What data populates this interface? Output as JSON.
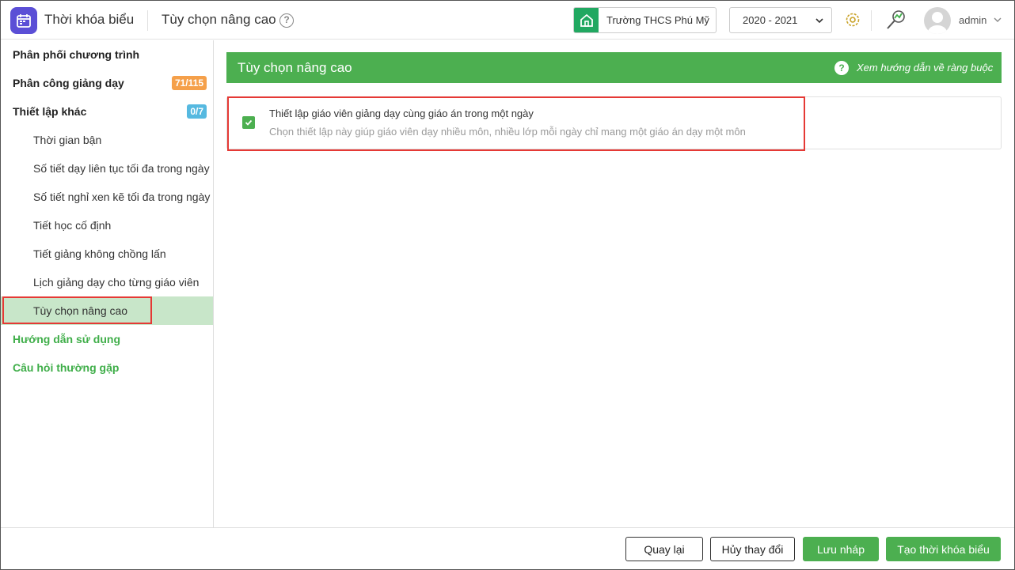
{
  "header": {
    "app_title": "Thời khóa biểu",
    "page_title": "Tùy chọn nâng cao",
    "school": "Trường THCS Phú Mỹ",
    "year": "2020 - 2021",
    "username": "admin",
    "help_icon": "question-circle-icon",
    "settings_icon": "gear-icon",
    "search_icon": "search-icon"
  },
  "sidebar": {
    "items": [
      {
        "label": "Phân phối chương trình"
      },
      {
        "label": "Phân công giảng dạy",
        "badge": "71/115"
      },
      {
        "label": "Thiết lập khác",
        "badge": "0/7"
      },
      {
        "label": "Thời gian bận"
      },
      {
        "label": "Số tiết dạy liên tục tối đa trong ngày"
      },
      {
        "label": "Số tiết nghỉ xen kẽ tối đa trong ngày"
      },
      {
        "label": "Tiết học cố định"
      },
      {
        "label": "Tiết giảng không chồng lấn"
      },
      {
        "label": "Lịch giảng dạy cho từng giáo viên"
      },
      {
        "label": "Tùy chọn nâng cao"
      },
      {
        "label": "Hướng dẫn sử dụng"
      },
      {
        "label": "Câu hỏi thường gặp"
      }
    ]
  },
  "main": {
    "banner_title": "Tùy chọn nâng cao",
    "banner_link": "Xem hướng dẫn về ràng buộc",
    "option": {
      "title": "Thiết lập giáo viên giảng dạy cùng giáo án trong một ngày",
      "description": "Chọn thiết lập này giúp giáo viên dạy nhiều môn, nhiều lớp mỗi ngày chỉ mang một giáo án dạy một môn",
      "checked": true
    }
  },
  "footer": {
    "back": "Quay lại",
    "discard": "Hủy thay đổi",
    "save_draft": "Lưu nháp",
    "create": "Tạo thời khóa biểu"
  },
  "colors": {
    "accent": "#4caf50",
    "active_bg": "#c8e6c9",
    "highlight_red": "#e53935"
  }
}
